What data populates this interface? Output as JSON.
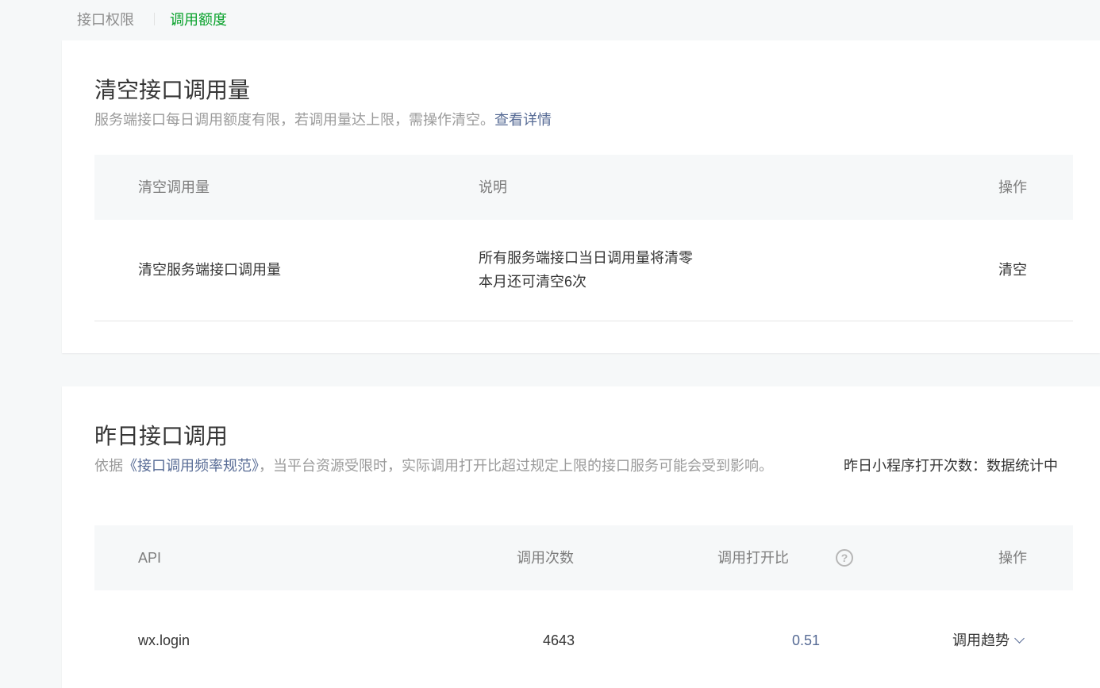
{
  "tabs": {
    "permission": "接口权限",
    "quota": "调用额度"
  },
  "clear_section": {
    "title": "清空接口调用量",
    "desc_text": "服务端接口每日调用额度有限，若调用量达上限，需操作清空。",
    "desc_link": "查看详情",
    "columns": {
      "name": "清空调用量",
      "desc": "说明",
      "action": "操作"
    },
    "row": {
      "name": "清空服务端接口调用量",
      "desc_line1": "所有服务端接口当日调用量将清零",
      "desc_line2": "本月还可清空6次",
      "action": "清空"
    }
  },
  "yesterday_section": {
    "title": "昨日接口调用",
    "desc_prefix": "依据",
    "desc_link": "《接口调用频率规范》",
    "desc_suffix": "，当平台资源受限时，实际调用打开比超过规定上限的接口服务可能会受到影响。",
    "open_count_label": "昨日小程序打开次数：",
    "open_count_value": "数据统计中",
    "columns": {
      "api": "API",
      "calls": "调用次数",
      "ratio": "调用打开比",
      "action": "操作"
    },
    "help_icon": "question-circle-icon",
    "rows": [
      {
        "api": "wx.login",
        "calls": "4643",
        "ratio": "0.51",
        "action": "调用趋势"
      }
    ]
  }
}
